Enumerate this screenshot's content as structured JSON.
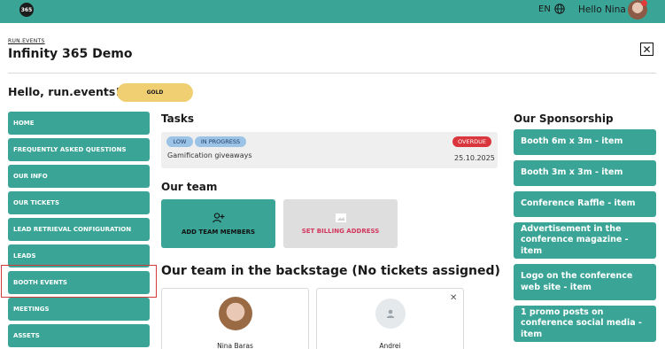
{
  "topbar": {
    "logo_text": "365",
    "language": "EN",
    "greeting": "Hello Nina"
  },
  "header": {
    "breadcrumb": "RUN.EVENTS",
    "title": "Infinity 365 Demo"
  },
  "welcome": {
    "text": "Hello, run.events! :)",
    "badge": "GOLD"
  },
  "sidebar": {
    "items": [
      {
        "label": "HOME"
      },
      {
        "label": "FREQUENTLY ASKED QUESTIONS"
      },
      {
        "label": "OUR INFO"
      },
      {
        "label": "OUR TICKETS"
      },
      {
        "label": "LEAD RETRIEVAL CONFIGURATION"
      },
      {
        "label": "LEADS"
      },
      {
        "label": "BOOTH EVENTS"
      },
      {
        "label": "MEETINGS"
      },
      {
        "label": "ASSETS"
      }
    ]
  },
  "tasks": {
    "title": "Tasks",
    "items": [
      {
        "priority": "LOW",
        "status": "IN PROGRESS",
        "flag": "OVERDUE",
        "name": "Gamification giveaways",
        "date": "25.10.2025"
      }
    ]
  },
  "team": {
    "title": "Our team",
    "add_label": "ADD TEAM MEMBERS",
    "billing_label": "SET BILLING ADDRESS"
  },
  "backstage": {
    "title": "Our team in the backstage (No tickets assigned)",
    "members": [
      {
        "name": "Nina Baras"
      },
      {
        "name": "Andrei"
      }
    ]
  },
  "sponsorship": {
    "title": "Our Sponsorship",
    "items": [
      {
        "label": "Booth 6m x 3m - item"
      },
      {
        "label": "Booth 3m x 3m - item"
      },
      {
        "label": "Conference Raffle - item"
      },
      {
        "label": "Advertisement in the conference magazine - item"
      },
      {
        "label": "Logo on the conference web site - item"
      },
      {
        "label": "1 promo posts on conference social media - item"
      }
    ]
  },
  "colors": {
    "brand": "#3aa597",
    "gold": "#f0cf73",
    "overdue": "#d9363e",
    "billing": "#d2365d"
  }
}
